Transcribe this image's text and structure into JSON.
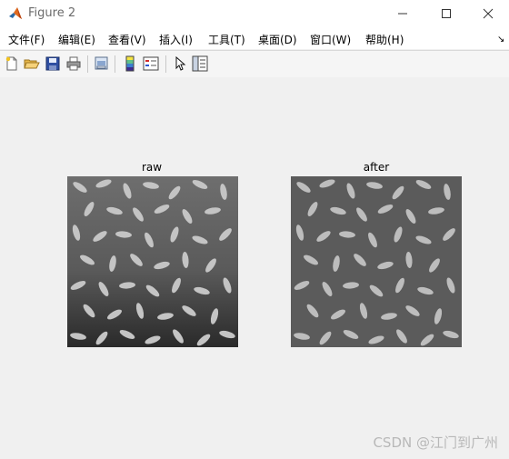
{
  "window": {
    "title": "Figure 2"
  },
  "menu": [
    {
      "label": "文件(F)"
    },
    {
      "label": "编辑(E)"
    },
    {
      "label": "查看(V)"
    },
    {
      "label": "插入(I)"
    },
    {
      "label": "工具(T)"
    },
    {
      "label": "桌面(D)"
    },
    {
      "label": "窗口(W)"
    },
    {
      "label": "帮助(H)"
    }
  ],
  "toolbar": {
    "buttons": [
      "new-figure-icon",
      "open-file-icon",
      "save-icon",
      "print-icon",
      "print-preview-icon",
      "colorbar-icon",
      "legend-icon",
      "select-pointer-icon",
      "property-inspector-icon"
    ]
  },
  "axes": [
    {
      "title": "raw"
    },
    {
      "title": "after"
    }
  ],
  "watermark": "CSDN @江门到广州"
}
